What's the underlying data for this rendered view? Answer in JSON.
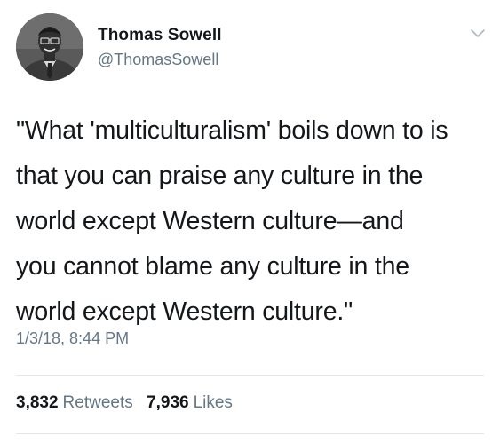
{
  "tweet": {
    "author": {
      "name": "Thomas Sowell",
      "handle": "@ThomasSowell",
      "avatar_icon": "profile-photo"
    },
    "menu_icon": "chevron-down-icon",
    "text": "\"What 'multiculturalism' boils down to is\nthat you can praise any culture in the\nworld except Western culture—and\nyou cannot blame any culture in the\nworld except Western culture.\"",
    "timestamp": "1/3/18, 8:44 PM",
    "stats": {
      "retweets_count": "3,832",
      "retweets_label": "Retweets",
      "likes_count": "7,936",
      "likes_label": "Likes"
    }
  },
  "colors": {
    "text_primary": "#14171a",
    "text_secondary": "#657786",
    "divider": "#e1e8ed",
    "background": "#ffffff"
  }
}
